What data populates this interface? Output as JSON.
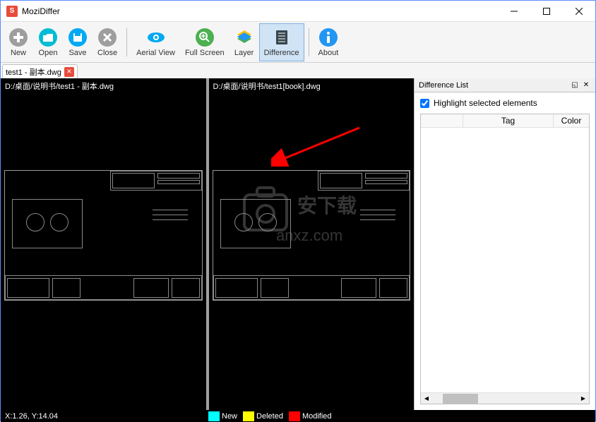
{
  "titlebar": {
    "title": "MoziDiffer",
    "icon_letter": "S"
  },
  "toolbar": {
    "new": "New",
    "open": "Open",
    "save": "Save",
    "close": "Close",
    "aerial_view": "Aerial View",
    "full_screen": "Full Screen",
    "layer": "Layer",
    "difference": "Difference",
    "about": "About"
  },
  "tabs": [
    {
      "label": "test1 - 副本.dwg"
    }
  ],
  "viewports": {
    "left_path": "D:/桌面/说明书/test1 - 副本.dwg",
    "right_path": "D:/桌面/说明书/test1[book].dwg"
  },
  "side_panel": {
    "title": "Difference List",
    "highlight_label": "Highlight selected elements",
    "highlight_checked": true,
    "columns": {
      "tag": "Tag",
      "color": "Color"
    }
  },
  "statusbar": {
    "coords": "X:1.26, Y:14.04",
    "legend": {
      "new": {
        "label": "New",
        "color": "#00FFFF"
      },
      "deleted": {
        "label": "Deleted",
        "color": "#FFFF00"
      },
      "modified": {
        "label": "Modified",
        "color": "#FF0000"
      }
    }
  },
  "watermark": {
    "text": "安下载",
    "url": "anxz.com"
  }
}
